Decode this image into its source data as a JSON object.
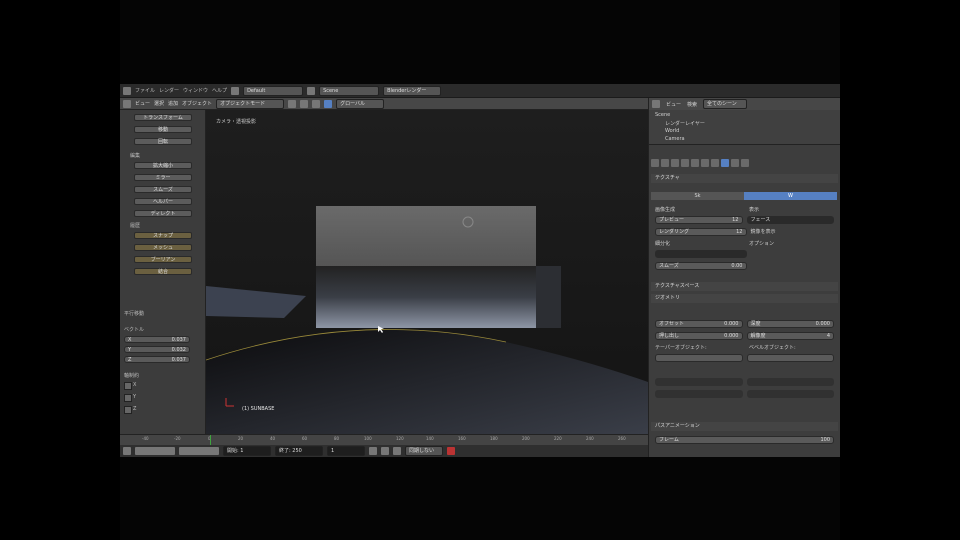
{
  "topbar": {
    "menus": [
      "ファイル",
      "レンダー",
      "ウィンドウ",
      "ヘルプ"
    ],
    "layout_field": "Default",
    "scene_field": "Scene",
    "engine_field": "Blenderレンダー"
  },
  "view3d_header": {
    "menus": [
      "ビュー",
      "選択",
      "追加",
      "オブジェクト"
    ],
    "mode": "オブジェクトモード",
    "shading": "グローバル"
  },
  "tool_shelf": {
    "buttons": [
      "トランスフォーム",
      "移動",
      "回転",
      "拡大縮小",
      "ミラー",
      "スムーズ",
      "ヘルパー",
      "ディレクト",
      "スナップ",
      "メッシュ",
      "ブーリアン",
      "結合"
    ],
    "section_edit": "編集",
    "section_history": "履歴",
    "section_transform": "平行移動",
    "vector_label": "ベクトル",
    "vector": [
      {
        "axis": "X",
        "value": "0.037"
      },
      {
        "axis": "Y",
        "value": "0.032"
      },
      {
        "axis": "Z",
        "value": "0.037"
      }
    ],
    "constraint_label": "軸制約",
    "checks": [
      "X",
      "Y",
      "Z"
    ]
  },
  "viewport": {
    "label": "カメラ・透視投影",
    "object_label": "(1) SUNBASE"
  },
  "timeline": {
    "ticks": [
      "-40",
      "-20",
      "0",
      "20",
      "40",
      "60",
      "80",
      "100",
      "120",
      "140",
      "160",
      "180",
      "200",
      "220",
      "240",
      "260"
    ]
  },
  "bottombar": {
    "start_label": "開始:",
    "start_value": "1",
    "end_label": "終了:",
    "end_value": "250",
    "current_value": "1",
    "sync": "同期しない"
  },
  "properties": {
    "header_menus": [
      "ビュー",
      "検索",
      "全てのシーン"
    ],
    "outliner": [
      "Scene",
      "レンダーレイヤー",
      "World",
      "Camera"
    ],
    "panel_title": "テクスチャ",
    "toggle": [
      "Sk",
      "W"
    ],
    "label_left": "画像生成",
    "label_right": "表示",
    "field_preview": "プレビュー",
    "field_preview_val": "12",
    "field_render": "レンダリング",
    "field_render_val": "12",
    "field_face": "フェース",
    "field_face_val": "",
    "subdiv_label": "細分化",
    "option_1": "鏡像を表示",
    "option_2": "オプション",
    "smooth_label": "スムーズ",
    "smooth_val": "0.00",
    "texture_space": "テクスチャスペース",
    "geometry": "ジオメトリ",
    "offset_label": "オフセット",
    "offset_val": "0.000",
    "extrude_label": "押し出し",
    "extrude_val": "0.000",
    "depth_label": "深度",
    "depth_val": "0.000",
    "res_label": "解像度",
    "res_val": "4",
    "taper_label": "テーパーオブジェクト:",
    "bevel_label": "ベベルオブジェクト:",
    "path_anim": "パスアニメーション",
    "frames_label": "フレーム",
    "frames_val": "100",
    "brand_color": "#5680c2"
  }
}
